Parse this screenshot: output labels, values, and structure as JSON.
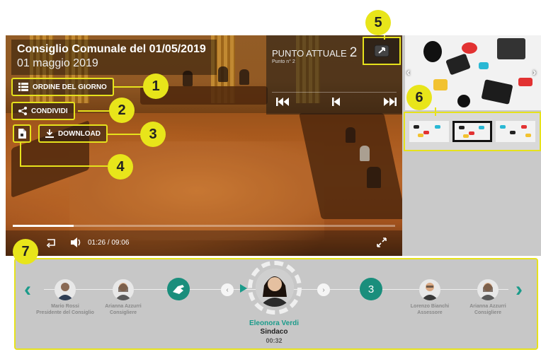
{
  "video": {
    "title": "Consiglio Comunale del 01/05/2019",
    "date": "01 maggio 2019",
    "agenda_label": "ORDINE DEL GIORNO",
    "share_label": "CONDIVIDI",
    "download_label": "DOWNLOAD",
    "punto_label": "PUNTO ATTUALE",
    "punto_number": "2",
    "punto_sub": "Punto n° 2",
    "current_time": "01:26",
    "duration": "09:06",
    "time_separator": "/",
    "progress_fraction": 0.16
  },
  "speakers": [
    {
      "name": "Mario Rossi",
      "role": "Presidente del Consiglio"
    },
    {
      "name": "Arianna Azzurri",
      "role": "Consigliere"
    },
    {
      "name": "Lorenzo Bianchi",
      "role": "Assessore"
    },
    {
      "name": "Arianna Azzurri",
      "role": "Consigliere"
    }
  ],
  "active_speaker": {
    "name": "Eleonora Verdi",
    "role": "Sindaco",
    "time": "00:32"
  },
  "queue_count": "3",
  "callouts": [
    "1",
    "2",
    "3",
    "4",
    "5",
    "6",
    "7"
  ],
  "colors": {
    "accent_teal": "#1a9b8a",
    "highlight_yellow": "#e6e21c"
  }
}
